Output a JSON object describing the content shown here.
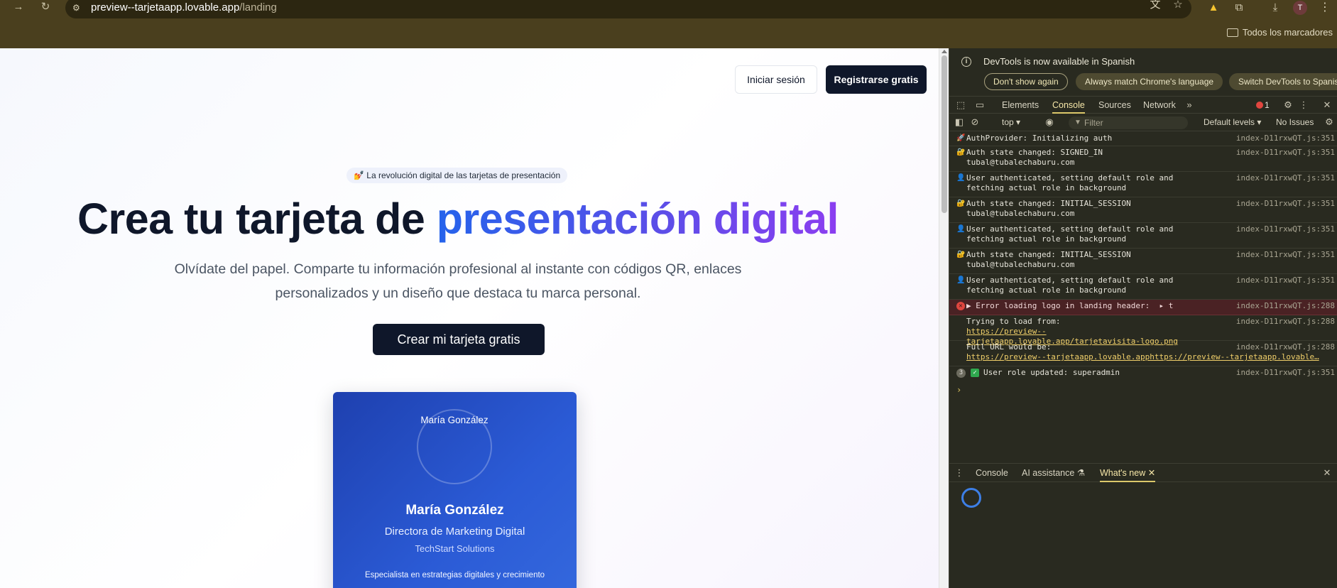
{
  "browser": {
    "url_host": "preview--tarjetaapp.lovable.app",
    "url_path": "/landing",
    "avatar_letter": "T",
    "bookmarks_label": "Todos los marcadores",
    "icons": [
      "back-arrow-icon",
      "reload-icon",
      "site-settings-icon",
      "translate-icon",
      "star-icon",
      "drive-icon",
      "extensions-icon",
      "download-icon",
      "profile-avatar",
      "menu-kebab-icon",
      "folder-icon"
    ]
  },
  "page": {
    "login_button": "Iniciar sesión",
    "register_button": "Registrarse gratis",
    "badge": "💅 La revolución digital de las tarjetas de presentación",
    "title_plain": "Crea tu tarjeta de ",
    "title_highlight": "presentación digital",
    "subtitle": "Olvídate del papel. Comparte tu información profesional al instante con códigos QR, enlaces personalizados y un diseño que destaca tu marca personal.",
    "cta_button": "Crear mi tarjeta gratis",
    "card": {
      "avatar_alt": "María González",
      "name": "María González",
      "role": "Directora de Marketing Digital",
      "company": "TechStart Solutions",
      "description": "Especialista en estrategias digitales y crecimiento"
    },
    "colors": {
      "primary": "#0f172a",
      "gradient_start": "#2563eb",
      "gradient_end": "#8b3ef0",
      "card_blue": "#1e40af"
    }
  },
  "devtools": {
    "banner_text": "DevTools is now available in Spanish",
    "banner_buttons": [
      "Don't show again",
      "Always match Chrome's language",
      "Switch DevTools to Spanish"
    ],
    "tabs": [
      "Elements",
      "Console",
      "Sources",
      "Network"
    ],
    "active_tab": "Console",
    "error_count": "1",
    "context": "top",
    "filter_placeholder": "Filter",
    "levels": "Default levels",
    "issues": "No Issues",
    "logs": [
      {
        "icon": "🚀",
        "message": "AuthProvider: Initializing auth",
        "source": "index-D11rxwQT.js:351"
      },
      {
        "icon": "🔐",
        "message": "Auth state changed: SIGNED_IN\ntubal@tubalechaburu.com",
        "source": "index-D11rxwQT.js:351"
      },
      {
        "icon": "👤",
        "message": "User authenticated, setting default role and\nfetching actual role in background",
        "source": "index-D11rxwQT.js:351"
      },
      {
        "icon": "🔐",
        "message": "Auth state changed: INITIAL_SESSION\ntubal@tubalechaburu.com",
        "source": "index-D11rxwQT.js:351"
      },
      {
        "icon": "👤",
        "message": "User authenticated, setting default role and\nfetching actual role in background",
        "source": "index-D11rxwQT.js:351"
      },
      {
        "icon": "🔐",
        "message": "Auth state changed: INITIAL_SESSION\ntubal@tubalechaburu.com",
        "source": "index-D11rxwQT.js:351"
      },
      {
        "icon": "👤",
        "message": "User authenticated, setting default role and\nfetching actual role in background",
        "source": "index-D11rxwQT.js:351"
      }
    ],
    "error_log": {
      "message": "▶ Error loading logo in landing header:  ▸ t",
      "source": "index-D11rxwQT.js:288"
    },
    "trying_log": {
      "label": "Trying to load from:",
      "link": "https://preview--tarjetaapp.lovable.app/tarjetavisita-logo.png",
      "source": "index-D11rxwQT.js:288"
    },
    "full_url_log": {
      "label": "Full URL would be:",
      "link": "https://preview--tarjetaapp.lovable.apphttps://preview--tarjetaapp.lovable…",
      "source": "index-D11rxwQT.js:288"
    },
    "role_log": {
      "count": "3",
      "message": "User role updated: superadmin",
      "source": "index-D11rxwQT.js:351"
    },
    "prompt": "›",
    "drawer_tabs": [
      "Console",
      "AI assistance",
      "What's new"
    ],
    "active_drawer_tab": "What's new"
  }
}
